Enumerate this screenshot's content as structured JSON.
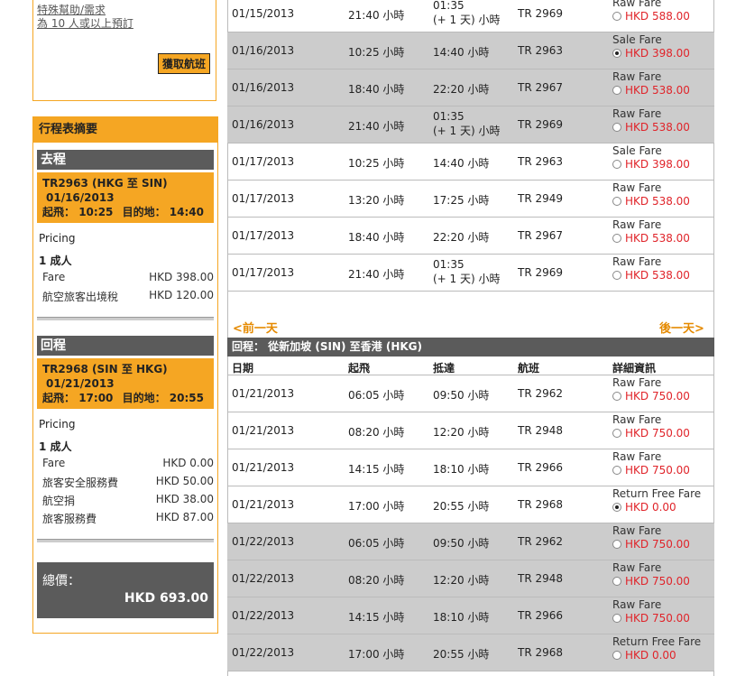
{
  "sidebar": {
    "links": [
      "特殊幫助/需求",
      "為 10 人或以上預訂"
    ],
    "fetch_button": "獲取航班",
    "summary_title": "行程表摘要",
    "outbound": {
      "heading": "去程",
      "flight": "TR2963 (HKG 至 SIN)",
      "date": "01/16/2013",
      "dep_label": "起飛：",
      "dep_time": "10:25",
      "arr_label": "目的地：",
      "arr_time": "14:40",
      "pricing_label": "Pricing",
      "pax": "1 成人",
      "fees": [
        {
          "name": "Fare",
          "value": "HKD 398.00"
        },
        {
          "name": "航空旅客出境稅",
          "value": "HKD 120.00"
        }
      ]
    },
    "return": {
      "heading": "回程",
      "flight": "TR2968 (SIN 至 HKG)",
      "date": "01/21/2013",
      "dep_label": "起飛：",
      "dep_time": "17:00",
      "arr_label": "目的地：",
      "arr_time": "20:55",
      "pricing_label": "Pricing",
      "pax": "1 成人",
      "fees": [
        {
          "name": "Fare",
          "value": "HKD 0.00"
        },
        {
          "name": "旅客安全服務費",
          "value": "HKD 50.00"
        },
        {
          "name": "航空捐",
          "value": "HKD 38.00"
        },
        {
          "name": "旅客服務費",
          "value": "HKD 87.00"
        }
      ]
    },
    "total_label": "總價：",
    "total_value": "HKD 693.00"
  },
  "outbound_rows": [
    {
      "date": "01/15/2013",
      "dep": "21:40 小時",
      "arr1": "01:35",
      "arr2": "(+ 1 天) 小時",
      "flight": "TR 2969",
      "fare_type": "Raw Fare",
      "fare_price": "HKD 588.00",
      "selected": false,
      "alt": false
    },
    {
      "date": "01/16/2013",
      "dep": "10:25 小時",
      "arr1": "14:40 小時",
      "arr2": "",
      "flight": "TR 2963",
      "fare_type": "Sale Fare",
      "fare_price": "HKD 398.00",
      "selected": true,
      "alt": true
    },
    {
      "date": "01/16/2013",
      "dep": "18:40 小時",
      "arr1": "22:20 小時",
      "arr2": "",
      "flight": "TR 2967",
      "fare_type": "Raw Fare",
      "fare_price": "HKD 538.00",
      "selected": false,
      "alt": true
    },
    {
      "date": "01/16/2013",
      "dep": "21:40 小時",
      "arr1": "01:35",
      "arr2": "(+ 1 天) 小時",
      "flight": "TR 2969",
      "fare_type": "Raw Fare",
      "fare_price": "HKD 538.00",
      "selected": false,
      "alt": true
    },
    {
      "date": "01/17/2013",
      "dep": "10:25 小時",
      "arr1": "14:40 小時",
      "arr2": "",
      "flight": "TR 2963",
      "fare_type": "Sale Fare",
      "fare_price": "HKD 398.00",
      "selected": false,
      "alt": false
    },
    {
      "date": "01/17/2013",
      "dep": "13:20 小時",
      "arr1": "17:25 小時",
      "arr2": "",
      "flight": "TR 2949",
      "fare_type": "Raw Fare",
      "fare_price": "HKD 538.00",
      "selected": false,
      "alt": false
    },
    {
      "date": "01/17/2013",
      "dep": "18:40 小時",
      "arr1": "22:20 小時",
      "arr2": "",
      "flight": "TR 2967",
      "fare_type": "Raw Fare",
      "fare_price": "HKD 538.00",
      "selected": false,
      "alt": false
    },
    {
      "date": "01/17/2013",
      "dep": "21:40 小時",
      "arr1": "01:35",
      "arr2": "(+ 1 天) 小時",
      "flight": "TR 2969",
      "fare_type": "Raw Fare",
      "fare_price": "HKD 538.00",
      "selected": false,
      "alt": false
    }
  ],
  "nav": {
    "prev": "<前一天",
    "next": "後一天>"
  },
  "return_bar": "回程： 從新加坡 (SIN) 至香港 (HKG)",
  "columns": [
    "日期",
    "起飛",
    "抵達",
    "航班",
    "詳細資訊"
  ],
  "return_rows": [
    {
      "date": "01/21/2013",
      "dep": "06:05 小時",
      "arr1": "09:50 小時",
      "arr2": "",
      "flight": "TR 2962",
      "fare_type": "Raw Fare",
      "fare_price": "HKD 750.00",
      "selected": false,
      "alt": false
    },
    {
      "date": "01/21/2013",
      "dep": "08:20 小時",
      "arr1": "12:20 小時",
      "arr2": "",
      "flight": "TR 2948",
      "fare_type": "Raw Fare",
      "fare_price": "HKD 750.00",
      "selected": false,
      "alt": false
    },
    {
      "date": "01/21/2013",
      "dep": "14:15 小時",
      "arr1": "18:10 小時",
      "arr2": "",
      "flight": "TR 2966",
      "fare_type": "Raw Fare",
      "fare_price": "HKD 750.00",
      "selected": false,
      "alt": false
    },
    {
      "date": "01/21/2013",
      "dep": "17:00 小時",
      "arr1": "20:55 小時",
      "arr2": "",
      "flight": "TR 2968",
      "fare_type": "Return Free Fare",
      "fare_price": "HKD 0.00",
      "selected": true,
      "alt": false
    },
    {
      "date": "01/22/2013",
      "dep": "06:05 小時",
      "arr1": "09:50 小時",
      "arr2": "",
      "flight": "TR 2962",
      "fare_type": "Raw Fare",
      "fare_price": "HKD 750.00",
      "selected": false,
      "alt": true
    },
    {
      "date": "01/22/2013",
      "dep": "08:20 小時",
      "arr1": "12:20 小時",
      "arr2": "",
      "flight": "TR 2948",
      "fare_type": "Raw Fare",
      "fare_price": "HKD 750.00",
      "selected": false,
      "alt": true
    },
    {
      "date": "01/22/2013",
      "dep": "14:15 小時",
      "arr1": "18:10 小時",
      "arr2": "",
      "flight": "TR 2966",
      "fare_type": "Raw Fare",
      "fare_price": "HKD 750.00",
      "selected": false,
      "alt": true
    },
    {
      "date": "01/22/2013",
      "dep": "17:00 小時",
      "arr1": "20:55 小時",
      "arr2": "",
      "flight": "TR 2968",
      "fare_type": "Return Free Fare",
      "fare_price": "HKD 0.00",
      "selected": false,
      "alt": true
    }
  ]
}
